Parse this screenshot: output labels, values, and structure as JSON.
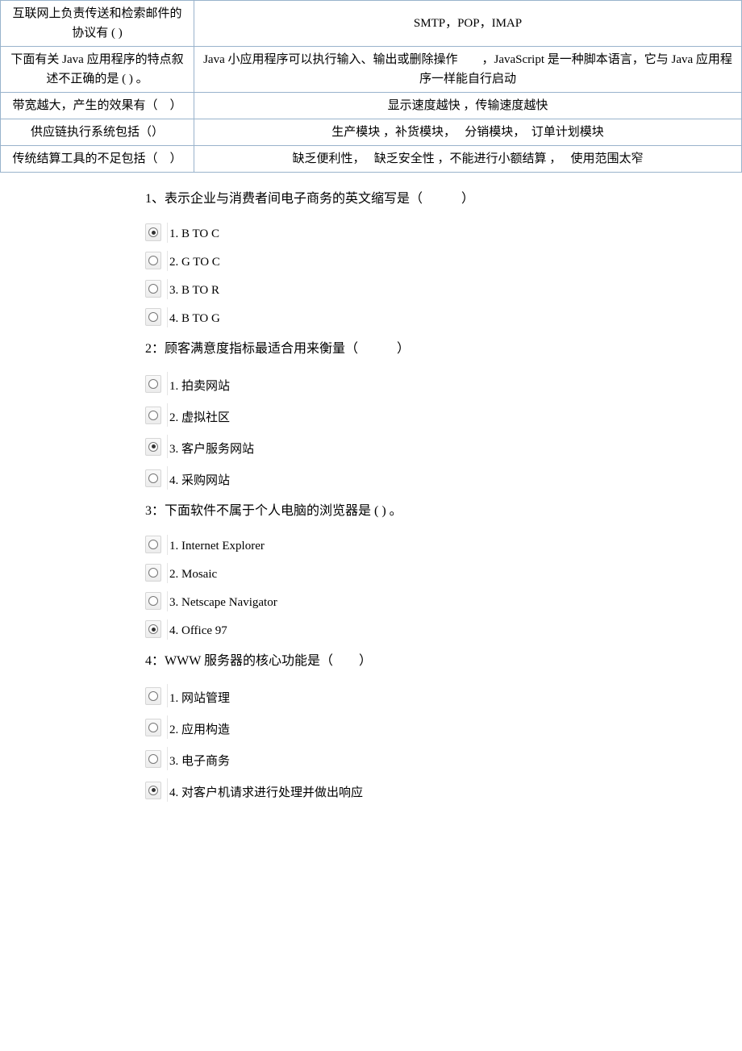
{
  "table_rows": [
    {
      "c1": "互联网上负责传送和检索邮件的协议有 ( )",
      "c2": "SMTP，POP，IMAP"
    },
    {
      "c1": "下面有关 Java 应用程序的特点叙述不正确的是 ( ) 。",
      "c2": "Java 小应用程序可以执行输入、输出或删除操作　　，JavaScript 是一种脚本语言，它与 Java 应用程序一样能自行启动"
    },
    {
      "c1": "带宽越大，产生的效果有（　）",
      "c2": "显示速度越快 ，传输速度越快"
    },
    {
      "c1": "供应链执行系统包括（）",
      "c2": "生产模块 ，补货模块，　 分销模块，　订单计划模块"
    },
    {
      "c1": "传统结算工具的不足包括（　）",
      "c2": "缺乏便利性，　 缺乏安全性 ，不能进行小额结算 ，　 使用范围太窄"
    }
  ],
  "questions": [
    {
      "text": "1、表示企业与消费者间电子商务的英文缩写是（　　　）",
      "options": [
        {
          "label": "1. B TO C",
          "checked": true
        },
        {
          "label": "2. G TO C",
          "checked": false
        },
        {
          "label": "3. B TO R",
          "checked": false
        },
        {
          "label": "4. B TO G",
          "checked": false
        }
      ]
    },
    {
      "text": "2：顾客满意度指标最适合用来衡量（　　　）",
      "options": [
        {
          "label": "1. 拍卖网站",
          "checked": false
        },
        {
          "label": "2. 虚拟社区",
          "checked": false
        },
        {
          "label": "3. 客户服务网站",
          "checked": true
        },
        {
          "label": "4. 采购网站",
          "checked": false
        }
      ]
    },
    {
      "text": "3：下面软件不属于个人电脑的浏览器是 ( ) 。",
      "options": [
        {
          "label": "1. Internet Explorer",
          "checked": false
        },
        {
          "label": "2. Mosaic",
          "checked": false
        },
        {
          "label": "3. Netscape Navigator",
          "checked": false
        },
        {
          "label": "4. Office 97",
          "checked": true
        }
      ]
    },
    {
      "text": "4：WWW 服务器的核心功能是（　　）",
      "options": [
        {
          "label": "1. 网站管理",
          "checked": false
        },
        {
          "label": "2. 应用构造",
          "checked": false
        },
        {
          "label": "3. 电子商务",
          "checked": false
        },
        {
          "label": "4. 对客户机请求进行处理并做出响应",
          "checked": true
        }
      ]
    }
  ]
}
